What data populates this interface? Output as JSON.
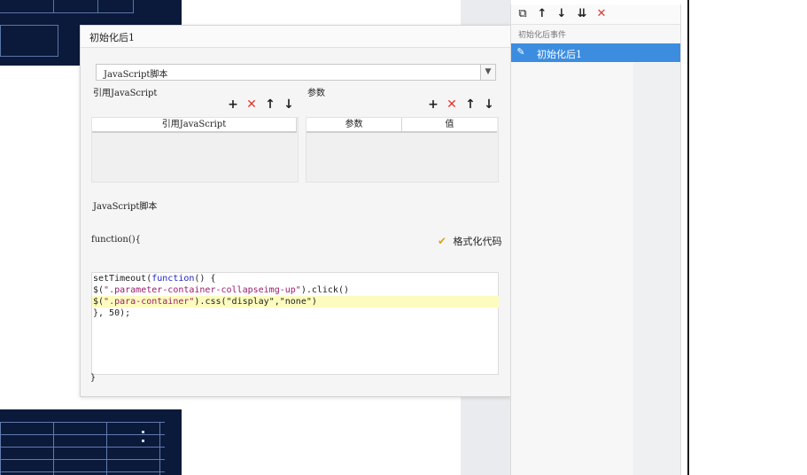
{
  "dialog": {
    "title": "初始化后1",
    "script_type": "JavaScript脚本",
    "ref_js_label": "引用JavaScript",
    "params_label": "参数",
    "ref_table_header": "引用JavaScript",
    "param_header": "参数",
    "value_header": "值",
    "script_label": "JavaScript脚本",
    "function_open": "function(){",
    "format_label": "格式化代码",
    "function_close": "}",
    "code": [
      [
        "setTimeout(",
        "function",
        "() {"
      ],
      [
        "$(",
        "\".parameter-container-collapseimg-up\"",
        ").click()"
      ],
      [
        "$(",
        "\".para-container\"",
        ").css(\"display\",\"none\")"
      ],
      [
        "}, 50);"
      ]
    ]
  },
  "right_panel": {
    "section_label": "初始化后事件",
    "items": [
      {
        "label": "初始化后1"
      }
    ]
  },
  "icons": {
    "add": "+",
    "delete": "✕",
    "up": "↑",
    "down": "↓",
    "copy": "⧉",
    "move_bottom": "⇊",
    "edit": "✎",
    "brush": "✔"
  },
  "colors": {
    "accent": "#3c8de0",
    "delete": "#e2382f",
    "highlight": "#fdfcbf"
  }
}
